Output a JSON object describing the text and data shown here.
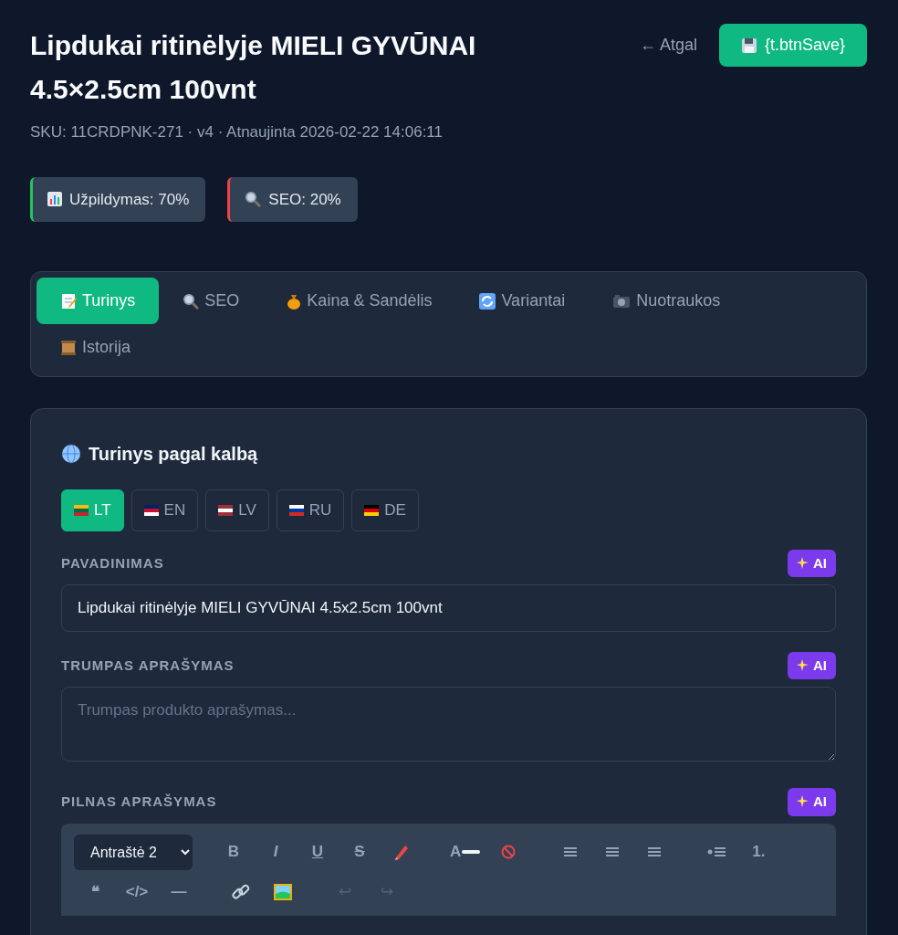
{
  "header": {
    "title": "Lipdukai ritinėlyje MIELI GYVŪNAI 4.5×2.5cm 100vnt",
    "meta": "SKU: 11CRDPNK-271 · v4 · Atnaujinta 2026-02-22 14:06:11",
    "back": "← Atgal",
    "save": "{t.btnSave}"
  },
  "stats": [
    {
      "label": "Užpildymas: 70%",
      "color": "#22c55e"
    },
    {
      "label": "SEO: 20%",
      "color": "#ef4444"
    }
  ],
  "tabs": [
    {
      "label": "Turinys",
      "selected": true
    },
    {
      "label": "SEO",
      "selected": false
    },
    {
      "label": "Kaina & Sandėlis",
      "selected": false
    },
    {
      "label": "Variantai",
      "selected": false
    },
    {
      "label": "Nuotraukos",
      "selected": false
    },
    {
      "label": "Istorija",
      "selected": false
    }
  ],
  "content": {
    "title": "Turinys pagal kalbą",
    "languages": [
      {
        "label": "LT",
        "selected": true
      },
      {
        "label": "EN",
        "selected": false
      },
      {
        "label": "LV",
        "selected": false
      },
      {
        "label": "RU",
        "selected": false
      },
      {
        "label": "DE",
        "selected": false
      }
    ],
    "fields": [
      {
        "kind": "input",
        "label": "PAVADINIMAS",
        "ai": "AI",
        "value": "Lipdukai ritinėlyje MIELI GYVŪNAI 4.5x2.5cm 100vnt"
      },
      {
        "kind": "textarea",
        "label": "TRUMPAS APRAŠYMAS",
        "ai": "AI",
        "placeholder": "Trumpas produkto aprašymas..."
      },
      {
        "kind": "editor",
        "label": "PILNAS APRAŠYMAS",
        "ai": "AI"
      }
    ],
    "editor": {
      "heading": "Antraštė 2",
      "toolbar": [
        [
          {
            "kind": "text",
            "label": "B"
          },
          {
            "kind": "text",
            "label": "I"
          },
          {
            "kind": "text",
            "label": "U"
          },
          {
            "kind": "text",
            "label": "S"
          },
          {
            "kind": "icon"
          }
        ],
        [
          {
            "kind": "color",
            "label": "A"
          },
          {
            "kind": "icon"
          }
        ],
        [
          {
            "kind": "icon"
          },
          {
            "kind": "icon"
          },
          {
            "kind": "icon"
          }
        ],
        [
          {
            "kind": "icon"
          },
          {
            "kind": "text",
            "label": "1."
          }
        ],
        [
          {
            "kind": "text",
            "label": "❝"
          },
          {
            "kind": "text",
            "label": "</>"
          },
          {
            "kind": "text",
            "label": "—"
          }
        ],
        [
          {
            "kind": "icon"
          },
          {
            "kind": "icon"
          }
        ],
        [
          {
            "kind": "text",
            "label": "↩",
            "disabled": true
          },
          {
            "kind": "text",
            "label": "↪",
            "disabled": true
          }
        ]
      ]
    }
  }
}
